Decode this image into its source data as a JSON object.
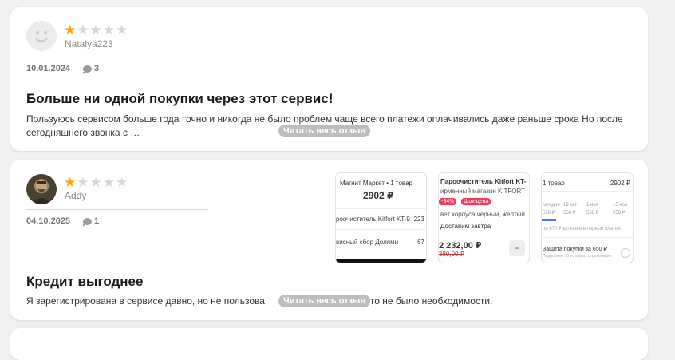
{
  "reviews": [
    {
      "author": "Natalya223",
      "rating": 1,
      "max_rating": 5,
      "date": "10.01.2024",
      "comments": "3",
      "title": "Больше ни одной покупки через этот сервис!",
      "text": "Пользуюсь сервисом больше года точно и никогда не было проблем чаще всего платежи оплачивались даже раньше срока Но после сегодняшнего звонка с …",
      "read_more": "Читать весь отзыв"
    },
    {
      "author": "Addy",
      "rating": 1,
      "max_rating": 5,
      "date": "04.10.2025",
      "comments": "1",
      "title": "Кредит выгоднее",
      "text_before": "Я зарегистрирована в сервисе давно, но не пользова",
      "text_after": "то не было необходимости.",
      "read_more": "Читать весь отзыв",
      "photos": [
        {
          "header": "Магнит Маркет • 1 товар",
          "total": "2902 ₽",
          "row1": "роочиститель Kitfort KT-9",
          "row1_value": "223",
          "row2": "висный сбор Долями",
          "row2_value": "67"
        },
        {
          "title": "Пароочиститель Kitfort KT-",
          "shop": "ирменный магазин KITFORT",
          "discount": "-34%",
          "badge": "Шок-цена",
          "color_line": "вет корпуса  черный, желтый",
          "delivery": "Доставим завтра",
          "price": "2 232,00 ₽",
          "old_price": "380,00 ₽"
        },
        {
          "header": "1 товар",
          "total": "2902 ₽",
          "sched": [
            "сегодня",
            "19 окт",
            "1 ноя",
            "15 ноя"
          ],
          "sched_sum": [
            "558 ₽",
            "558 ₽",
            "558 ₽",
            "558 ₽"
          ],
          "note": "ри 670 ₽ включен в первый платеж",
          "protect": "Защита покупки за 650 ₽",
          "protect_sub": "Подробнее об условиях страхования"
        }
      ]
    }
  ],
  "colors": {
    "star_on": "#ffa10b",
    "star_off": "#d6d6d6",
    "read_more_bg": "#bdbdbd",
    "discount": "#f23a5d"
  }
}
